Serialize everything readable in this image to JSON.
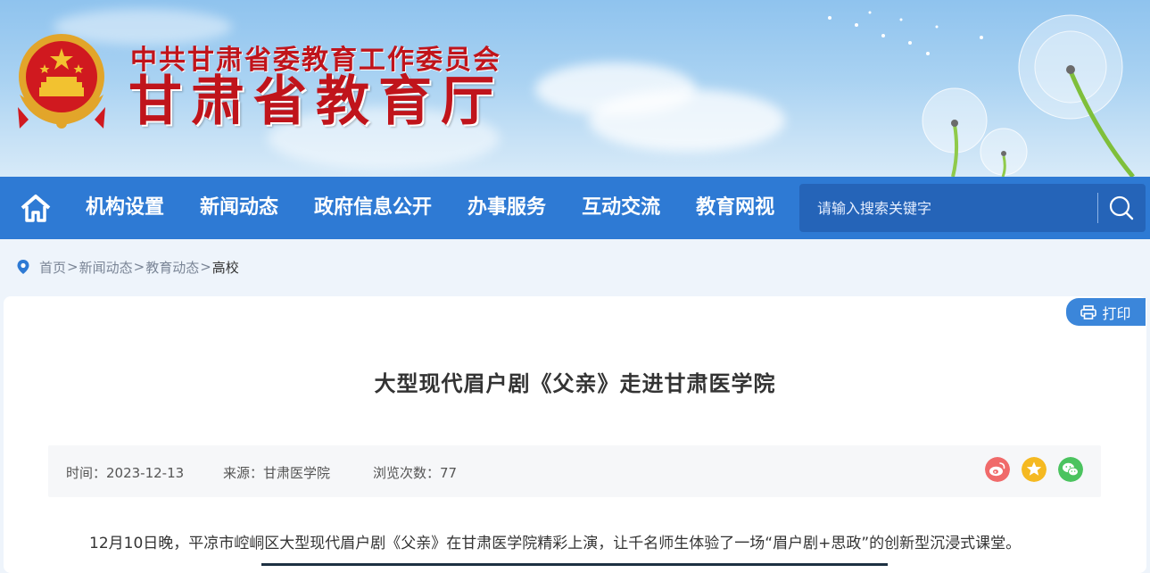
{
  "header": {
    "org_sub": "中共甘肃省委教育工作委员会",
    "org_main": "甘肃省教育厅",
    "emblem_icon": "national-emblem-icon"
  },
  "nav": {
    "home_icon": "home-icon",
    "items": [
      {
        "label": "机构设置"
      },
      {
        "label": "新闻动态"
      },
      {
        "label": "政府信息公开"
      },
      {
        "label": "办事服务"
      },
      {
        "label": "互动交流"
      },
      {
        "label": "教育网视"
      }
    ],
    "search": {
      "placeholder": "请输入搜索关键字",
      "value": "",
      "icon": "search-icon"
    }
  },
  "breadcrumb": {
    "icon": "location-pin-icon",
    "items": [
      {
        "label": "首页"
      },
      {
        "label": "新闻动态"
      },
      {
        "label": "教育动态"
      }
    ],
    "separator": ">",
    "current": "高校"
  },
  "article": {
    "print_label": "打印",
    "title": "大型现代眉户剧《父亲》走进甘肃医学院",
    "meta": {
      "time": "时间：2023-12-13",
      "source": "来源：甘肃医学院",
      "views": "浏览次数：77"
    },
    "share_icons": [
      "weibo-icon",
      "favorite-star-icon",
      "wechat-icon"
    ],
    "body_first_paragraph": "12月10日晚，平凉市崆峒区大型现代眉户剧《父亲》在甘肃医学院精彩上演，让千名师生体验了一场“眉户剧+思政”的创新型沉浸式课堂。"
  },
  "colors": {
    "nav_bg": "#2e7ad4",
    "title_red": "#c0141b",
    "print_bg": "#3b86da",
    "weibo": "#f06a6a",
    "star": "#f5b921",
    "wechat": "#4bc35f"
  }
}
